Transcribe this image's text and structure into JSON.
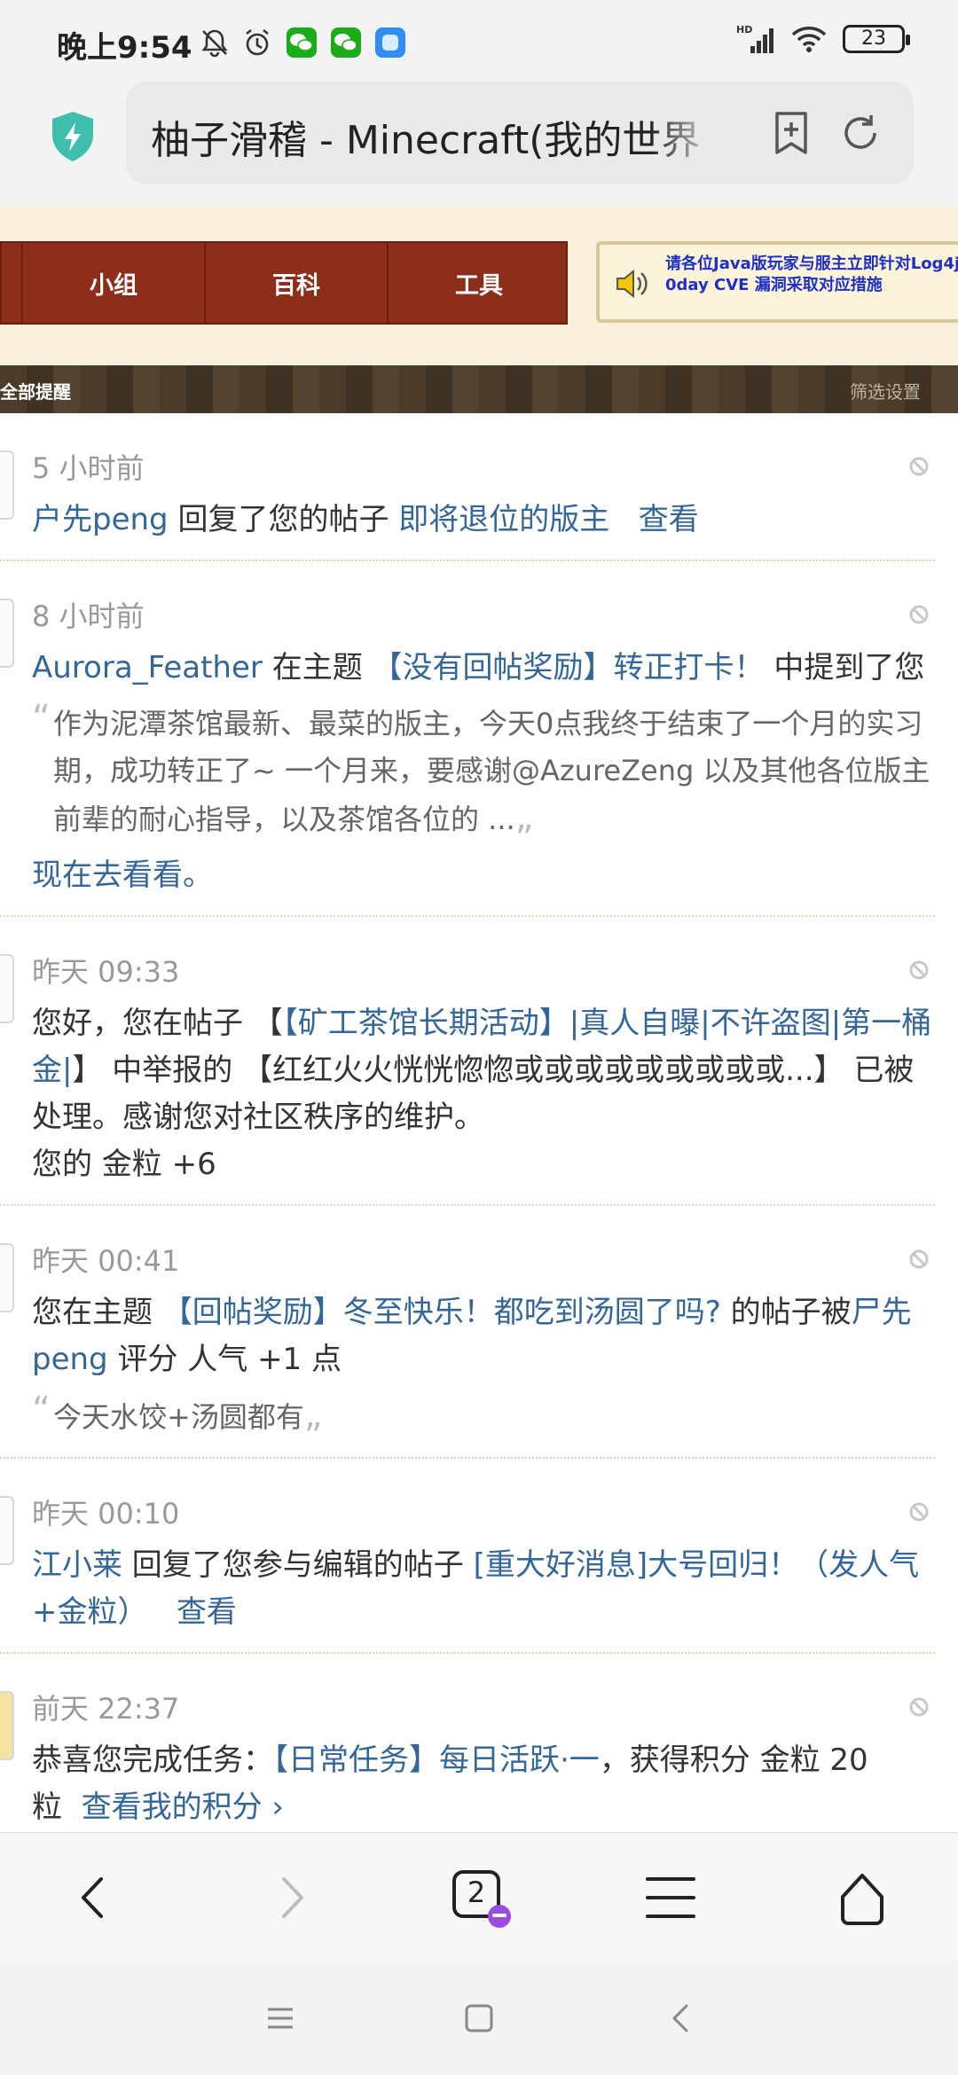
{
  "status": {
    "time": "晚上9:54",
    "battery": "23",
    "network": "HD"
  },
  "browser": {
    "title": "柚子滑稽 - Minecraft(我的世界"
  },
  "site_nav": {
    "items": [
      "小组",
      "百科",
      "工具"
    ],
    "announcement": "请各位Java版玩家与服主立即针对Log4j 0day CVE 漏洞采取对应措施"
  },
  "filter": {
    "all_label": "全部提醒",
    "settings_label": "筛选设置"
  },
  "notifications": [
    {
      "time": "5 小时前",
      "user": "户先peng",
      "text1": " 回复了您的帖子 ",
      "post": "即将退位的版主",
      "view": "查看"
    },
    {
      "time": "8 小时前",
      "user": "Aurora_Feather",
      "text1": " 在主题 ",
      "post": "【没有回帖奖励】转正打卡！",
      "text2": " 中提到了您",
      "quote": "作为泥潭茶馆最新、最菜的版主，今天0点我终于结束了一个月的实习期，成功转正了~ 一个月来，要感谢@AzureZeng 以及其他各位版主前辈的耐心指导，以及茶馆各位的 ...",
      "goto": "现在去看看。"
    },
    {
      "time": "昨天 09:33",
      "text1": "您好，您在帖子 【",
      "post": "【矿工茶馆长期活动】|真人自曝|不许盗图|第一桶金|",
      "text2": "】 中举报的 【红红火火恍恍惚惚或或或或或或或或或...】 已被处理。感谢您对社区秩序的维护。",
      "text3": "您的 金粒 +6"
    },
    {
      "time": "昨天 00:41",
      "text1": "您在主题 ",
      "post": "【回帖奖励】冬至快乐！都吃到汤圆了吗?",
      "text2": " 的帖子被",
      "user": "尸先peng",
      "text3": " 评分 人气 +1 点",
      "quote": "今天水饺+汤圆都有"
    },
    {
      "time": "昨天 00:10",
      "user": "江小莱",
      "text1": " 回复了您参与编辑的帖子 ",
      "post": "[重大好消息]大号回归！（发人气+金粒）",
      "view": "查看"
    },
    {
      "time": "前天 22:37",
      "text1": "恭喜您完成任务：",
      "post": "【日常任务】每日活跃·一",
      "text2": "，获得积分 金粒 20 粒",
      "view": "查看我的积分 ›"
    }
  ],
  "toolbar": {
    "tab_count": "2"
  }
}
